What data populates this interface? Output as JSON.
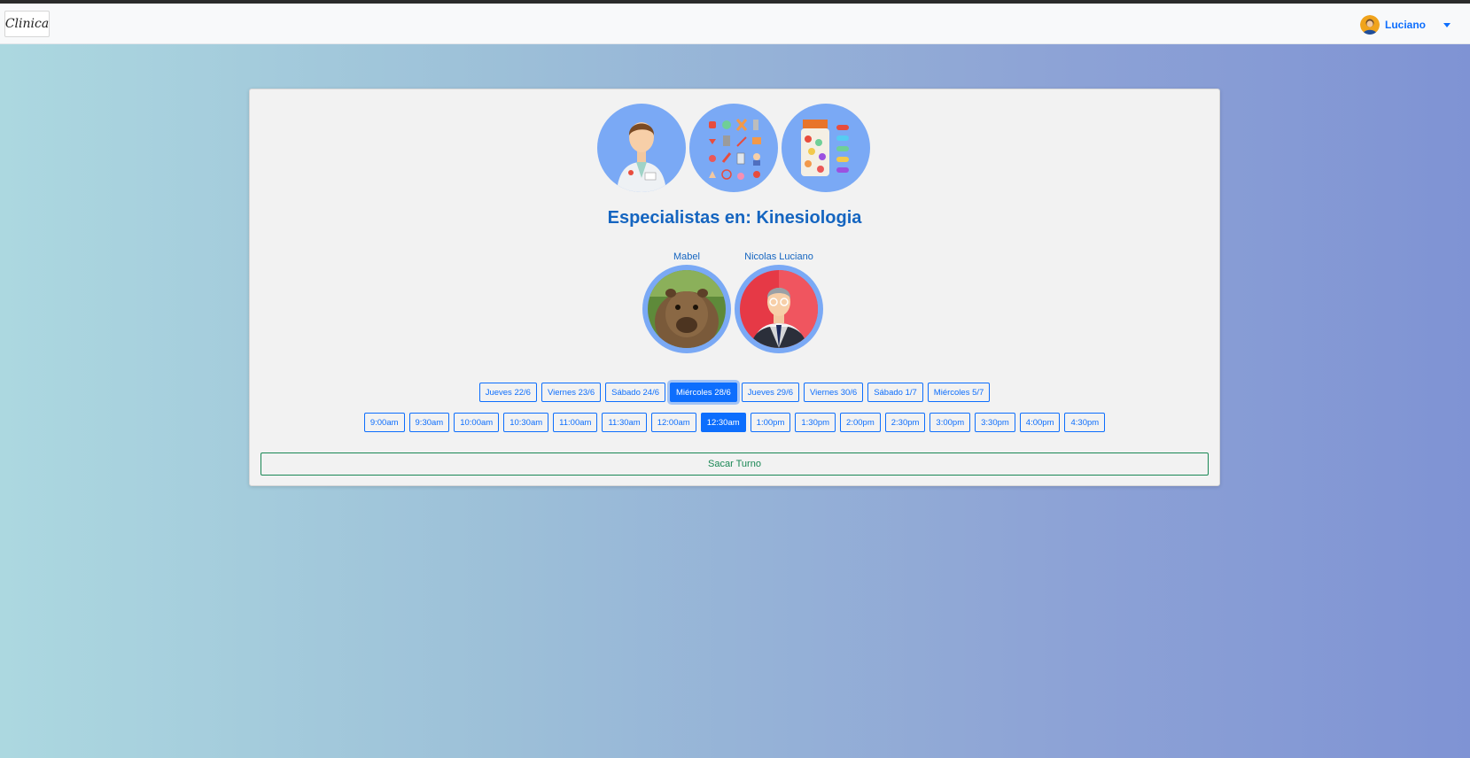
{
  "navbar": {
    "brand": "Clinica",
    "user_name": "Luciano"
  },
  "colors": {
    "primary": "#0d6efd",
    "success": "#198754",
    "title": "#1565c0",
    "circle_bg": "#7aa9f5"
  },
  "specialties": [
    {
      "icon": "doctor-icon"
    },
    {
      "icon": "medical-tools-icon"
    },
    {
      "icon": "pills-icon"
    }
  ],
  "heading": {
    "text": "Especialistas en: Kinesiologia"
  },
  "doctors": [
    {
      "name": "Mabel",
      "photo": "capybara-photo"
    },
    {
      "name": "Nicolas Luciano",
      "photo": "businessman-avatar"
    }
  ],
  "days": [
    "Jueves 22/6",
    "Viernes 23/6",
    "Sábado 24/6",
    "Miércoles 28/6",
    "Jueves 29/6",
    "Viernes 30/6",
    "Sábado 1/7",
    "Miércoles 5/7"
  ],
  "selected_day": "Miércoles 28/6",
  "times": [
    "9:00am",
    "9:30am",
    "10:00am",
    "10:30am",
    "11:00am",
    "11:30am",
    "12:00am",
    "12:30am",
    "1:00pm",
    "1:30pm",
    "2:00pm",
    "2:30pm",
    "3:00pm",
    "3:30pm",
    "4:00pm",
    "4:30pm"
  ],
  "selected_time": "12:30am",
  "submit_label": "Sacar Turno"
}
